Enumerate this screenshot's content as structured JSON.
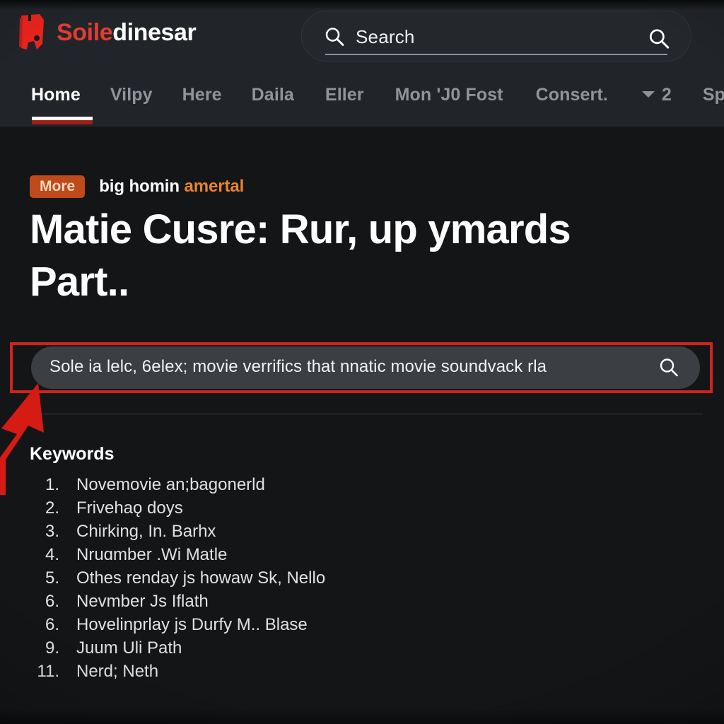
{
  "brand": {
    "logo_icon": "bookmark-film-icon",
    "name_first": "Soile",
    "name_second": "dinesar"
  },
  "header": {
    "search": {
      "placeholder": "Search",
      "left_icon": "search-icon",
      "right_icon": "search-icon"
    }
  },
  "nav": {
    "items": [
      {
        "label": "Home",
        "active": true
      },
      {
        "label": "Vilpy",
        "active": false
      },
      {
        "label": "Here",
        "active": false
      },
      {
        "label": "Daila",
        "active": false
      },
      {
        "label": "Eller",
        "active": false
      },
      {
        "label": "Mon 'J0 Fost",
        "active": false
      },
      {
        "label": "Consert.",
        "active": false
      },
      {
        "label": "2",
        "active": false,
        "icon": "chevron-down-icon"
      },
      {
        "label": "Spacec",
        "active": false
      }
    ]
  },
  "article": {
    "badge": "More",
    "kicker_white": "big homin",
    "kicker_orange": "amertal",
    "headline": "Matie Cusre: Rur, up ymards Part.."
  },
  "main_search": {
    "value": "Sole ia lelc, 6elex; movie verrifics that nnatic movie soundvack rla",
    "icon": "search-icon",
    "highlighted": true
  },
  "keywords": {
    "title": "Keywords",
    "items": [
      {
        "num": "1.",
        "text": "Novemovie an;bagonerld"
      },
      {
        "num": "2.",
        "text": "Frivehaǫ doys"
      },
      {
        "num": "3.",
        "text": "Chirking, In. Barhx"
      },
      {
        "num": "4.",
        "text": "Nruɑmber .Wi Matle"
      },
      {
        "num": "5.",
        "text": "Othes renday js howaw Sk, Nello"
      },
      {
        "num": "6.",
        "text": "Nevmber Js Iflath"
      },
      {
        "num": "6.",
        "text": "Hovelinprlay js Durfy M.. Blase"
      },
      {
        "num": "9.",
        "text": "Juum Uli Path"
      },
      {
        "num": "11.",
        "text": "Nerd; Neth"
      }
    ]
  },
  "annotation": {
    "arrow_icon": "arrow-up-right-icon",
    "highlight_color": "#d2221c",
    "arrow_color": "#d51b14"
  },
  "colors": {
    "page_bg": "#141517",
    "header_bg": "#212429",
    "brand_red": "#e23b33",
    "badge_orange": "#bf4a1b",
    "kicker_orange": "#e8852f",
    "active_underline": "#9e1f18"
  }
}
